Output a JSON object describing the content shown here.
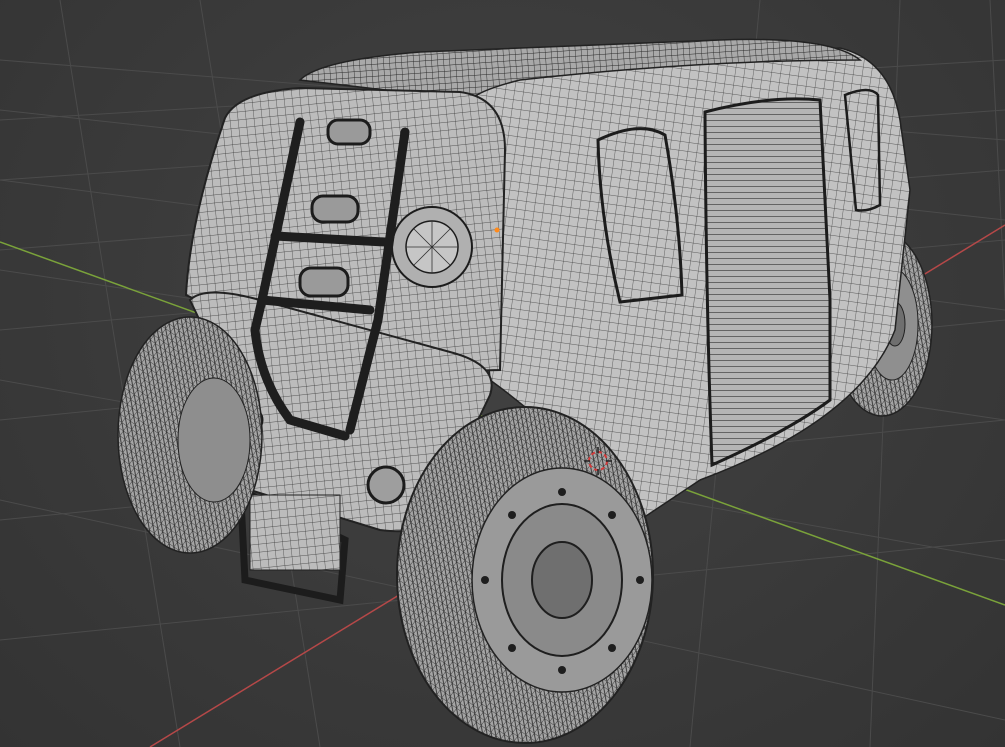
{
  "app": "3D viewport",
  "view": {
    "shading": "wireframe-over-solid",
    "subject": "off-road-van-model",
    "grid_visible": true
  },
  "colors": {
    "background": "#3a3a3a",
    "grid_line": "#4b4b4b",
    "x_axis": "#b54848",
    "y_axis": "#7aa23a",
    "mesh_fill": "#bdbdbd",
    "mesh_wire": "#2b2b2b",
    "tire_fill": "#a8a8a8",
    "ladder": "#1e1e1e",
    "cursor_red": "#d33a3a",
    "selected_vertex": "#ff8a1a"
  },
  "icons": {
    "cursor": "3d-cursor-icon",
    "origin": "object-origin-icon"
  }
}
